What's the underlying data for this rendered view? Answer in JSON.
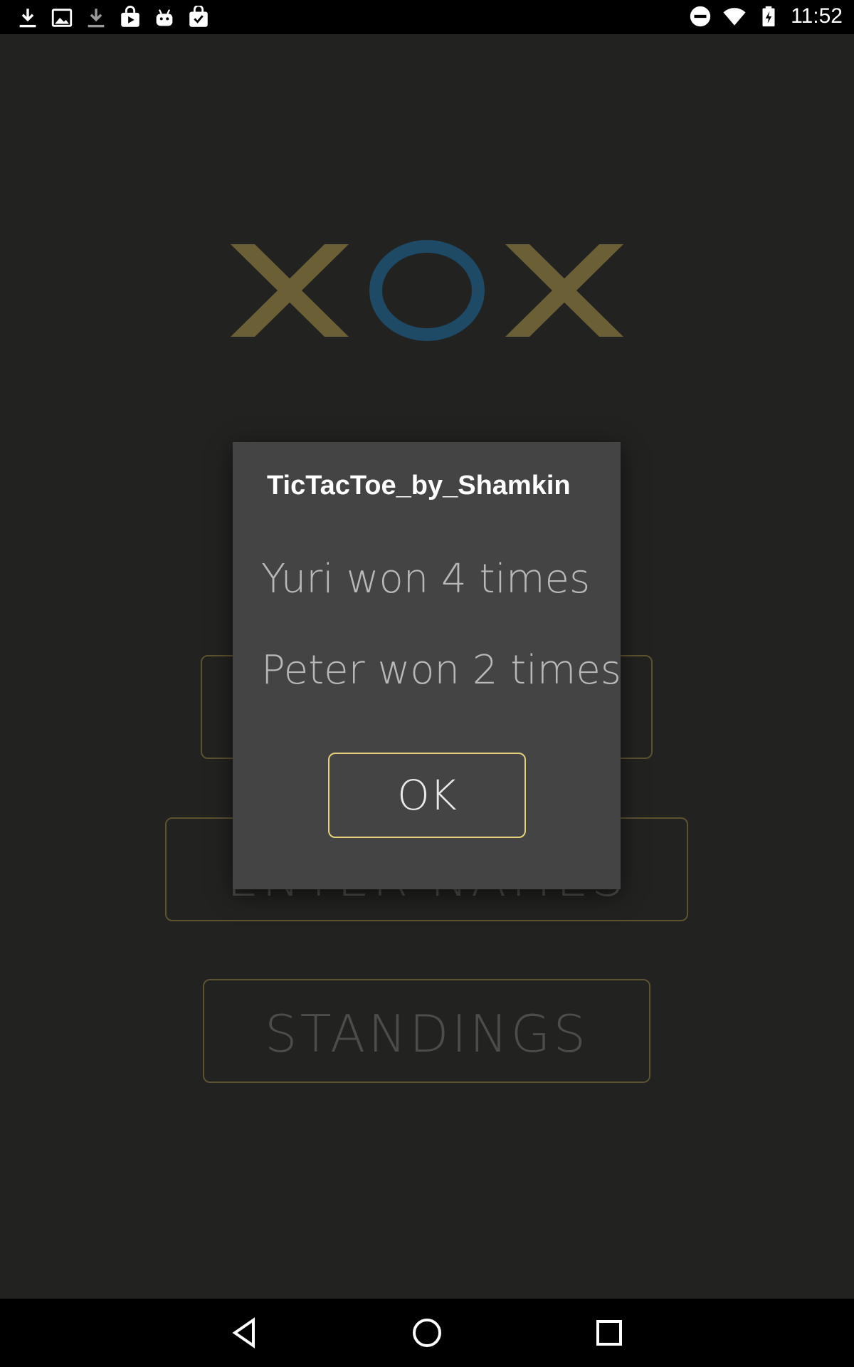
{
  "status_bar": {
    "time": "11:52",
    "left_icons": [
      "download-icon",
      "image-icon",
      "download-dim-icon",
      "play-store-icon",
      "android-icon",
      "clipboard-check-icon"
    ],
    "right_icons": [
      "do-not-disturb-icon",
      "wifi-icon",
      "battery-charging-icon"
    ]
  },
  "app": {
    "logo_text": "XOX",
    "logo_colors": {
      "x": "#6b5f36",
      "o": "#1e4a66"
    },
    "buttons": {
      "names_partial": "ENTER NAMES",
      "standings": "STANDINGS"
    }
  },
  "dialog": {
    "title": "TicTacToe_by_Shamkin",
    "line1": "Yuri won 4 times",
    "line2": "Peter won 2 times",
    "ok_label": "OK"
  },
  "colors": {
    "background": "#222220",
    "dialog": "#444444",
    "ok_border": "#e6d27a",
    "menu_border": "#5c5230"
  }
}
